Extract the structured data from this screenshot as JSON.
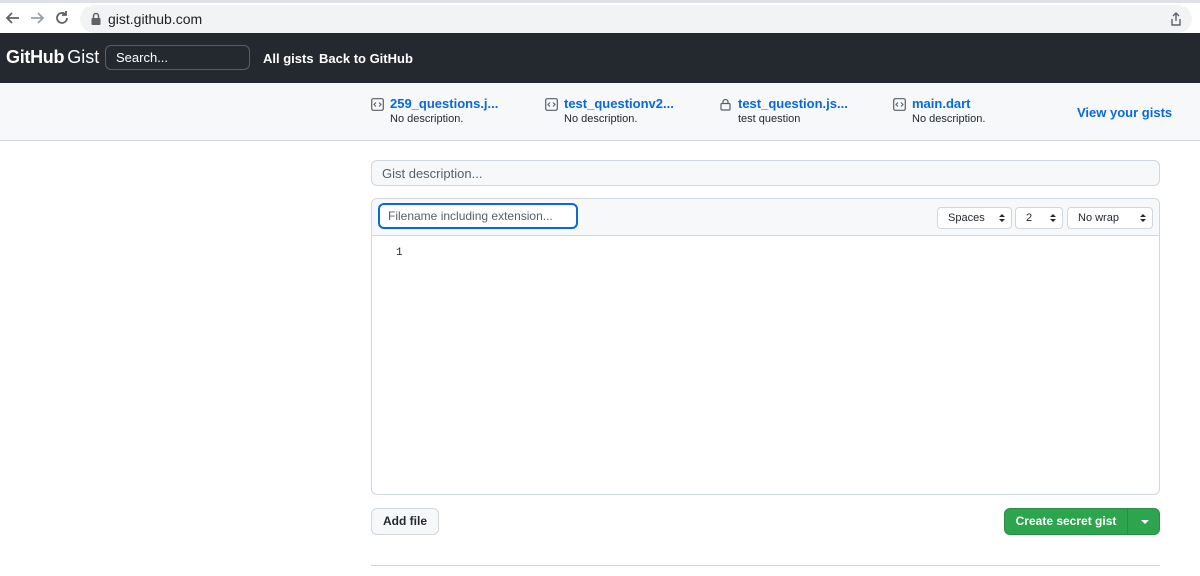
{
  "browser": {
    "url": "gist.github.com",
    "icons": [
      "back-arrow-icon",
      "forward-arrow-icon",
      "reload-icon",
      "lock-icon",
      "share-icon"
    ]
  },
  "header": {
    "logo_bold": "GitHub",
    "logo_light": "Gist",
    "search_placeholder": "Search...",
    "links": [
      "All gists",
      "Back to GitHub"
    ]
  },
  "recent_gists": [
    {
      "name": "259_questions.j...",
      "description": "No description.",
      "icon": "code-square-icon"
    },
    {
      "name": "test_questionv2...",
      "description": "No description.",
      "icon": "code-square-icon"
    },
    {
      "name": "test_question.js...",
      "description": "test question",
      "icon": "lock-icon"
    },
    {
      "name": "main.dart",
      "description": "No description.",
      "icon": "code-square-icon"
    }
  ],
  "view_gists_label": "View your gists",
  "form": {
    "description_placeholder": "Gist description...",
    "filename_placeholder": "Filename including extension...",
    "indent_mode": "Spaces",
    "indent_size": "2",
    "wrap_mode": "No wrap",
    "line_number": "1",
    "add_file_label": "Add file",
    "create_label": "Create secret gist"
  },
  "colors": {
    "header_bg": "#24292f",
    "link_blue": "#0969da",
    "create_green": "#2da44e"
  }
}
